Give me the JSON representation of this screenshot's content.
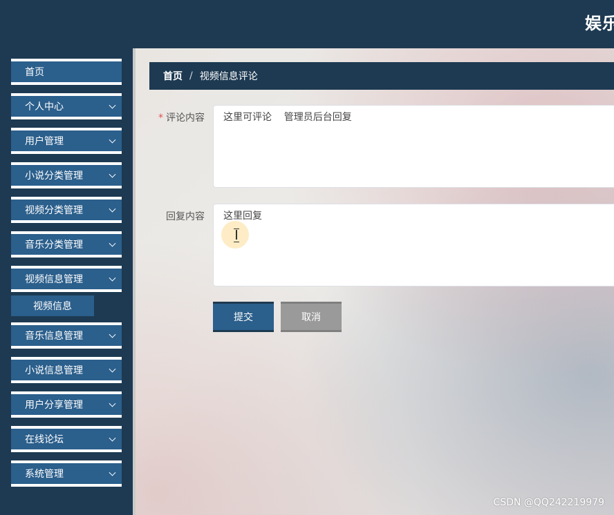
{
  "header": {
    "brand": "娱乐"
  },
  "sidebar": {
    "items": [
      {
        "label": "首页",
        "expandable": false
      },
      {
        "label": "个人中心",
        "expandable": true
      },
      {
        "label": "用户管理",
        "expandable": true
      },
      {
        "label": "小说分类管理",
        "expandable": true
      },
      {
        "label": "视频分类管理",
        "expandable": true
      },
      {
        "label": "音乐分类管理",
        "expandable": true
      },
      {
        "label": "视频信息管理",
        "expandable": true
      },
      {
        "label": "音乐信息管理",
        "expandable": true
      },
      {
        "label": "小说信息管理",
        "expandable": true
      },
      {
        "label": "用户分享管理",
        "expandable": true
      },
      {
        "label": "在线论坛",
        "expandable": true
      },
      {
        "label": "系统管理",
        "expandable": true
      }
    ],
    "subitem": {
      "label": "视频信息"
    }
  },
  "breadcrumb": {
    "home": "首页",
    "separator": "/",
    "current": "视频信息评论"
  },
  "form": {
    "comment": {
      "label": "评论内容",
      "required_mark": "*",
      "value": "这里可评论    管理员后台回复"
    },
    "reply": {
      "label": "回复内容",
      "value": "这里回复"
    },
    "submit_label": "提交",
    "cancel_label": "取消"
  },
  "watermark": "CSDN @QQ242219979",
  "colors": {
    "header_bg": "#1e3a52",
    "menu_bg": "#2b5f8c",
    "cancel_bg": "#9a9a9a",
    "required": "#e4514e"
  }
}
